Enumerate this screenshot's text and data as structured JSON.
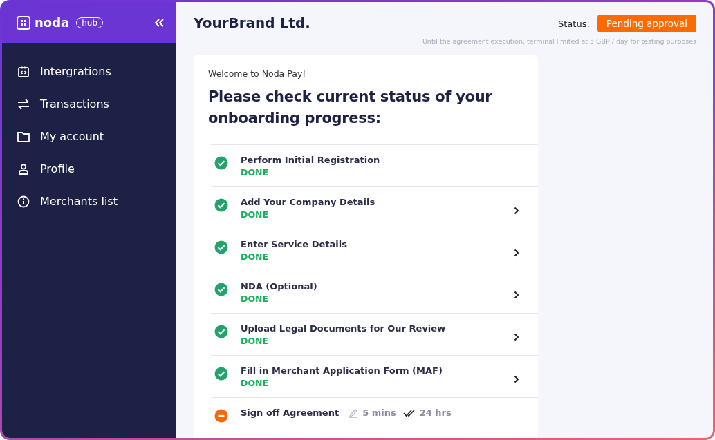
{
  "sidebar": {
    "logo": "noda",
    "badge": "hub",
    "items": [
      {
        "label": "Intergrations",
        "kind": "code"
      },
      {
        "label": "Transactions",
        "kind": "arrows"
      },
      {
        "label": "My account",
        "kind": "folder"
      },
      {
        "label": "Profile",
        "kind": "person"
      },
      {
        "label": "Merchants list",
        "kind": "info"
      }
    ]
  },
  "header": {
    "title": "YourBrand Ltd.",
    "status_label": "Status:",
    "status": "Pending approval",
    "note": "Until the agreement execution, terminal limited at 5 GBP / day for testing purposes"
  },
  "card": {
    "welcome": "Welcome to Noda Pay!",
    "heading": "Please check current status of your onboarding progress:",
    "steps": [
      {
        "title": "Perform Initial Registration",
        "kind": "done",
        "status_text": "DONE",
        "has_arrow": false
      },
      {
        "title": "Add Your Company Details",
        "kind": "done",
        "status_text": "DONE",
        "has_arrow": true
      },
      {
        "title": "Enter Service Details",
        "kind": "done",
        "status_text": "DONE",
        "has_arrow": true
      },
      {
        "title": "NDA (Optional)",
        "kind": "done",
        "status_text": "DONE",
        "has_arrow": true
      },
      {
        "title": "Upload Legal Documents for Our Review",
        "kind": "done",
        "status_text": "DONE",
        "has_arrow": true
      },
      {
        "title": "Fill in Merchant Application Form (MAF)",
        "kind": "done",
        "status_text": "DONE",
        "has_arrow": true
      },
      {
        "title": "Sign off Agreement",
        "kind": "pending",
        "has_arrow": false,
        "effort": "5 mins",
        "turnaround": "24 hrs"
      }
    ]
  }
}
